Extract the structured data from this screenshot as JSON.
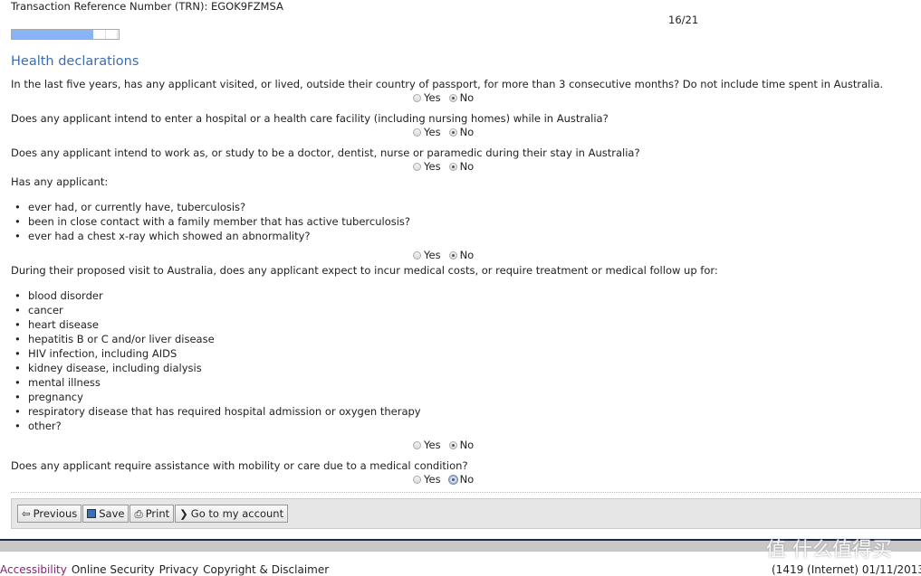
{
  "header": {
    "trn_label": "Transaction Reference Number (TRN): EGOK9FZMSA",
    "page_counter": "16/21",
    "progress_percent": 76
  },
  "section_title": "Health declarations",
  "radio_labels": {
    "yes": "Yes",
    "no": "No"
  },
  "questions": [
    {
      "text": "In the last five years, has any applicant visited, or lived, outside their country of passport, for more than 3 consecutive months? Do not include time spent in Australia.",
      "answer": "No"
    },
    {
      "text": "Does any applicant intend to enter a hospital or a health care facility (including nursing homes) while in Australia?",
      "answer": "No"
    },
    {
      "text": "Does any applicant intend to work as, or study to be a doctor, dentist, nurse or paramedic during their stay in Australia?",
      "answer": "No"
    },
    {
      "text": "Has any applicant:",
      "items": [
        "ever had, or currently have, tuberculosis?",
        "been in close contact with a family member that has active tuberculosis?",
        "ever had a chest x-ray which showed an abnormality?"
      ],
      "answer": "No"
    },
    {
      "text": "During their proposed visit to Australia, does any applicant expect to incur medical costs, or require treatment or medical follow up for:",
      "items": [
        "blood disorder",
        "cancer",
        "heart disease",
        "hepatitis B or C and/or liver disease",
        "HIV infection, including AIDS",
        "kidney disease, including dialysis",
        "mental illness",
        "pregnancy",
        "respiratory disease that has required hospital admission or oxygen therapy",
        "other?"
      ],
      "answer": "No"
    },
    {
      "text": "Does any applicant require assistance with mobility or care due to a medical condition?",
      "answer": "No"
    }
  ],
  "buttons": {
    "previous": "Previous",
    "save": "Save",
    "print": "Print",
    "account": "Go to my account"
  },
  "footer": {
    "links": [
      "Accessibility",
      "Online Security",
      "Privacy",
      "Copyright & Disclaimer"
    ],
    "version": "(1419 (Internet) 01/11/2013"
  },
  "watermark": "值 什么值得买"
}
